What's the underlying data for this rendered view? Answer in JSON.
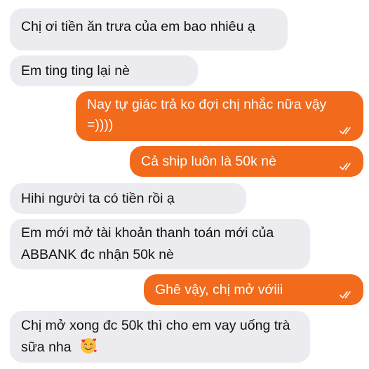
{
  "messages": [
    {
      "direction": "incoming",
      "text": "Chị ơi tiền ăn trưa của em bao nhiêu ạ"
    },
    {
      "direction": "incoming",
      "text": "Em ting ting lại nè"
    },
    {
      "direction": "outgoing",
      "text": "Nay tự giác trả ko đợi chị nhắc nữa vậy =))))",
      "status_icon": "double-check-icon"
    },
    {
      "direction": "outgoing",
      "text": "Cả ship luôn là 50k nè",
      "status_icon": "double-check-icon"
    },
    {
      "direction": "incoming",
      "text": "Hihi người ta có tiền rồi ạ"
    },
    {
      "direction": "incoming",
      "text": "Em mới mở tài khoản thanh toán mới của ABBANK đc nhận 50k nè"
    },
    {
      "direction": "outgoing",
      "text": "Ghê vậy, chị mở vớiii",
      "status_icon": "double-check-icon"
    },
    {
      "direction": "incoming",
      "text": "Chị mở xong đc 50k thì cho em vay uống trà sữa nha",
      "emoji": "smiling-face-with-hearts-icon"
    }
  ],
  "colors": {
    "incoming_bubble": "#ececf0",
    "outgoing_bubble": "#f26a1b",
    "incoming_text": "#111111",
    "outgoing_text": "#ffffff",
    "check_mark": "#ffffff"
  }
}
